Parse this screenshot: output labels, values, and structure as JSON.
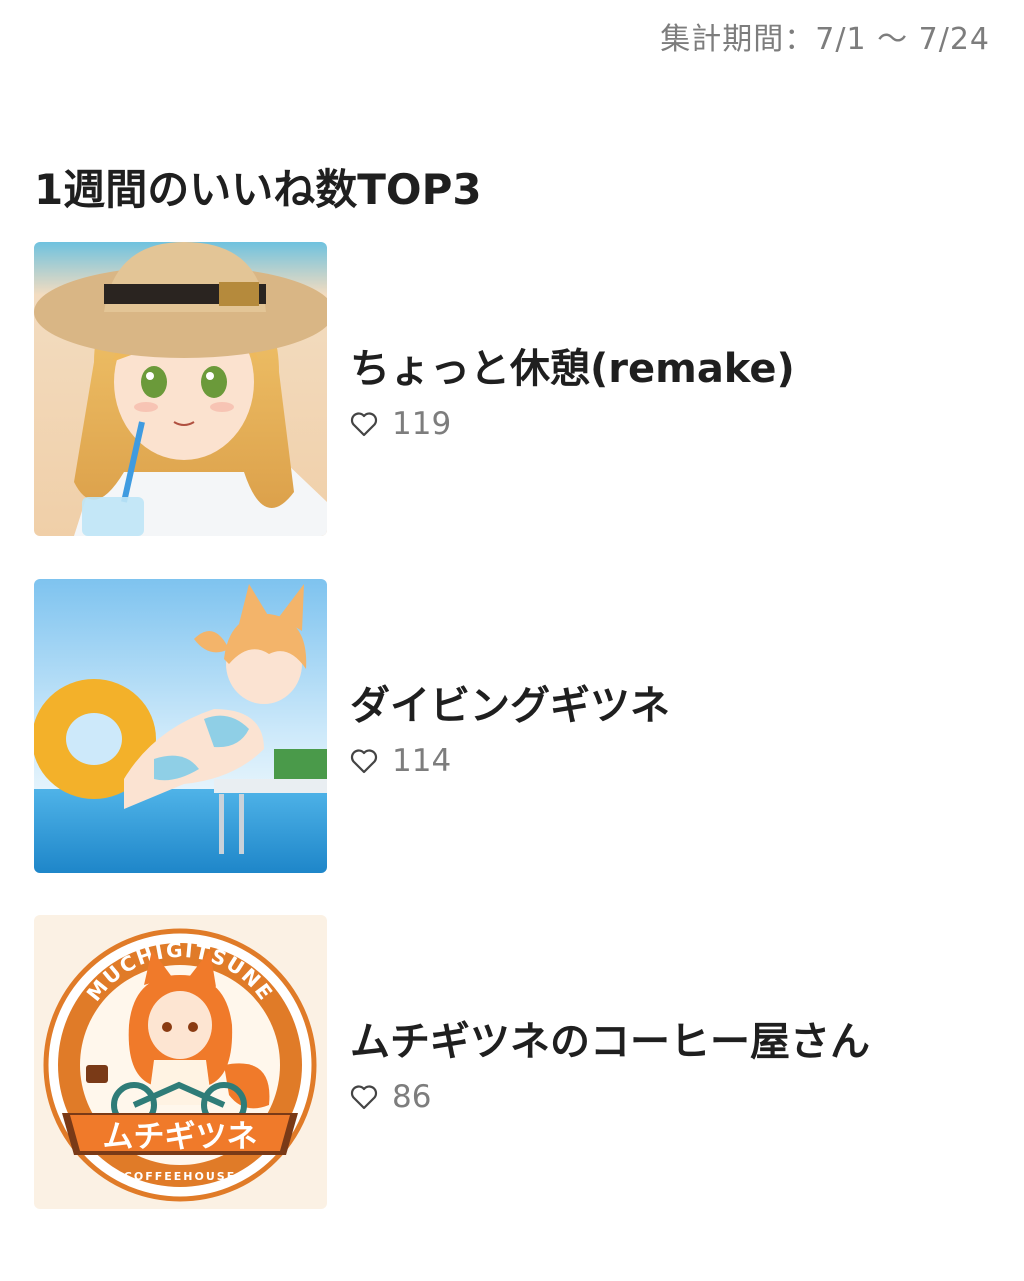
{
  "header": {
    "period_label": "集計期間：7/1 〜 7/24"
  },
  "section": {
    "title": "1週間のいいね数TOP3"
  },
  "ranking": [
    {
      "title": "ちょっと休憩(remake)",
      "likes": "119",
      "icon": "heart-outline-icon"
    },
    {
      "title": "ダイビングギツネ",
      "likes": "114",
      "icon": "heart-outline-icon"
    },
    {
      "title": "ムチギツネのコーヒー屋さん",
      "likes": "86",
      "icon": "heart-outline-icon"
    }
  ],
  "logo": {
    "arc_text": "MUCHIGITSUNE",
    "banner_text": "ムチギツネ",
    "sub_text": "COFFEEHOUSE"
  },
  "colors": {
    "title_text": "#1f1f1f",
    "muted_text": "#7d7d7d",
    "logo_orange": "#e07b28",
    "logo_cream": "#fbf1e4"
  }
}
